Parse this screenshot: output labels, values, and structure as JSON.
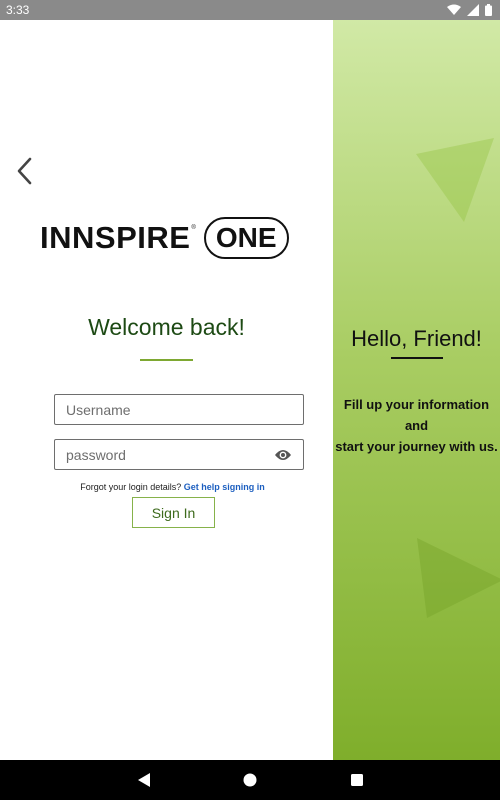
{
  "status_bar": {
    "time": "3:33",
    "icons": [
      "wifi-icon",
      "signal-icon",
      "battery-icon"
    ]
  },
  "login": {
    "brand_main": "INNSPIRE",
    "brand_tm": "®",
    "brand_pill": "ONE",
    "welcome_title": "Welcome back!",
    "username_placeholder": "Username",
    "password_placeholder": "password",
    "forgot_text": "Forgot your login details?",
    "help_link": "Get help signing in",
    "sign_in_label": "Sign In"
  },
  "side_panel": {
    "title": "Hello, Friend!",
    "line1": "Fill up your information",
    "line2": "and",
    "line3": "start your journey with us."
  },
  "colors": {
    "accent_green": "#7ea832",
    "welcome_text": "#1d4a14",
    "link_blue": "#1d5fc0",
    "panel_gradient_top": "#d1e9a6",
    "panel_gradient_bottom": "#7fae2b"
  },
  "nav_bar": {
    "icons": [
      "back-triangle-icon",
      "home-circle-icon",
      "recents-square-icon"
    ]
  }
}
